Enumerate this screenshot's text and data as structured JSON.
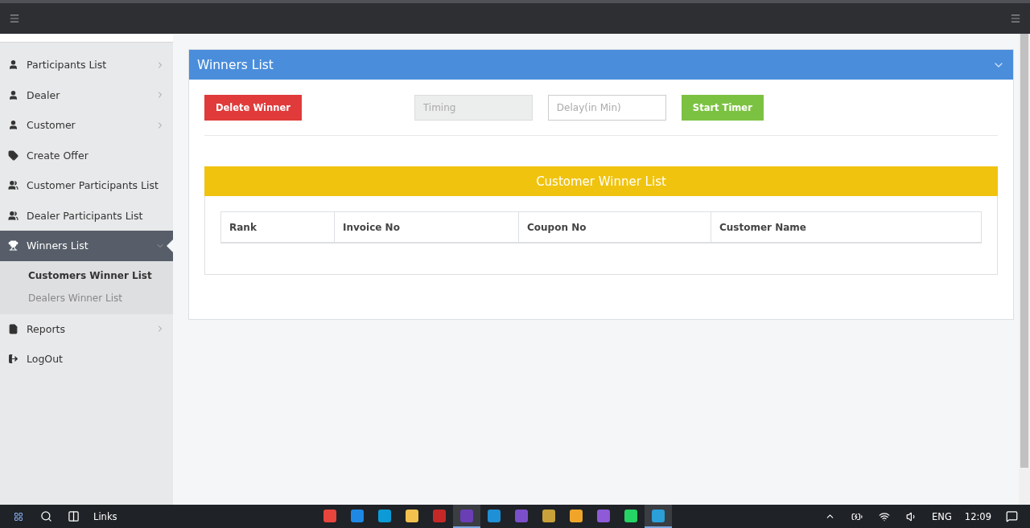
{
  "sidebar": {
    "items": [
      {
        "label": "Participants List",
        "kind": "menu",
        "expanded": false,
        "selected": false
      },
      {
        "label": "Dealer",
        "kind": "menu",
        "expanded": false,
        "selected": false
      },
      {
        "label": "Customer",
        "kind": "menu",
        "expanded": false,
        "selected": false
      },
      {
        "label": "Create Offer",
        "kind": "link",
        "selected": false
      },
      {
        "label": "Customer Participants List",
        "kind": "link",
        "selected": false
      },
      {
        "label": "Dealer Participants List",
        "kind": "link",
        "selected": false
      },
      {
        "label": "Winners List",
        "kind": "menu",
        "expanded": true,
        "selected": true,
        "children": [
          {
            "label": "Customers Winner List",
            "selected": true
          },
          {
            "label": "Dealers Winner List",
            "selected": false
          }
        ]
      },
      {
        "label": "Reports",
        "kind": "menu",
        "expanded": false,
        "selected": false
      },
      {
        "label": "LogOut",
        "kind": "link",
        "selected": false
      }
    ]
  },
  "panel": {
    "title": "Winners List",
    "delete_button": "Delete Winner",
    "timing_field": {
      "placeholder": "Timing",
      "disabled": true
    },
    "delay_field": {
      "placeholder": "Delay(in Min)",
      "disabled": false
    },
    "start_button": "Start Timer",
    "table_title": "Customer Winner List",
    "table": {
      "columns": [
        "Rank",
        "Invoice No",
        "Coupon No",
        "Customer Name"
      ]
    }
  },
  "taskbar": {
    "search_label": "Links",
    "apps": [
      {
        "color": "#e8453c",
        "active": false
      },
      {
        "color": "#1e88e5",
        "active": false
      },
      {
        "color": "#0c9bd6",
        "active": false
      },
      {
        "color": "#f2c14e",
        "active": false
      },
      {
        "color": "#c62828",
        "active": false
      },
      {
        "color": "#6a3fb5",
        "active": true
      },
      {
        "color": "#1f8fd6",
        "active": false
      },
      {
        "color": "#7b4fc9",
        "active": false
      },
      {
        "color": "#c8a13a",
        "active": false
      },
      {
        "color": "#f0a52a",
        "active": false
      },
      {
        "color": "#8e5ad8",
        "active": false
      },
      {
        "color": "#25d366",
        "active": false
      },
      {
        "color": "#2a9fd8",
        "active": true
      }
    ],
    "language": "ENG",
    "time": "12:09"
  }
}
